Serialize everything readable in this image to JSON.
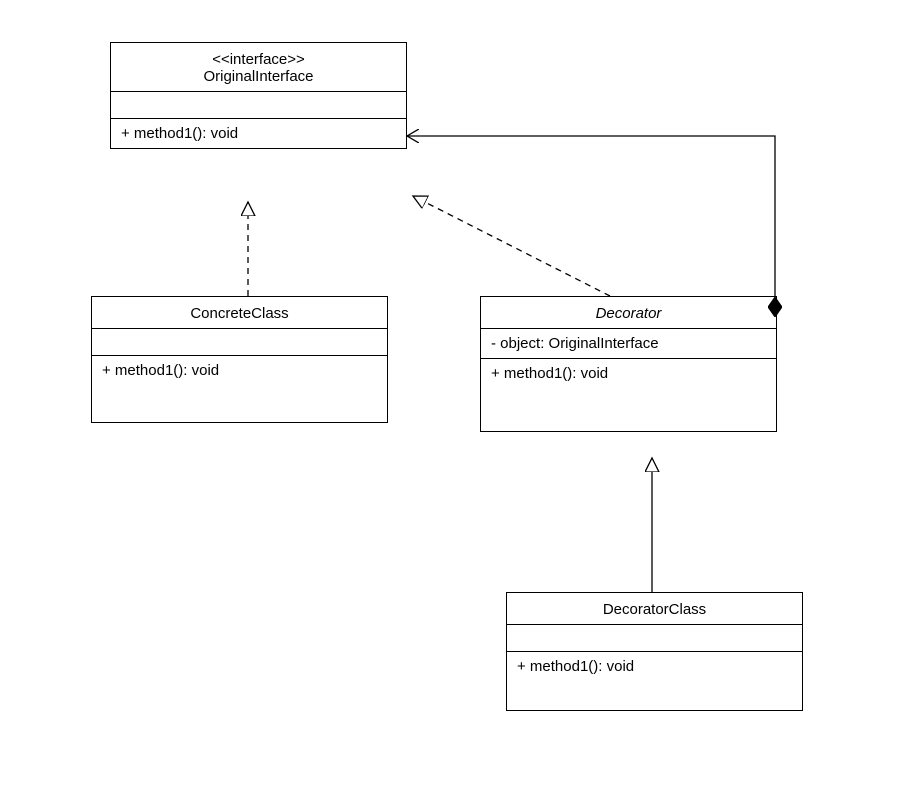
{
  "classes": {
    "originalInterface": {
      "stereotype": "<<interface>>",
      "name": "OriginalInterface",
      "attrs": "",
      "methods": "+ method1(): void"
    },
    "concreteClass": {
      "name": "ConcreteClass",
      "attrs": "",
      "methods": "+ method1(): void"
    },
    "decorator": {
      "name": "Decorator",
      "attrs": "- object: OriginalInterface",
      "methods": "+ method1(): void"
    },
    "decoratorClass": {
      "name": "DecoratorClass",
      "attrs": "",
      "methods": "+ method1(): void"
    }
  },
  "chart_data": {
    "type": "uml_class_diagram",
    "pattern": "Decorator",
    "classes": [
      {
        "id": "OriginalInterface",
        "stereotype": "interface",
        "abstract": true,
        "attributes": [],
        "methods": [
          "+ method1(): void"
        ]
      },
      {
        "id": "ConcreteClass",
        "attributes": [],
        "methods": [
          "+ method1(): void"
        ]
      },
      {
        "id": "Decorator",
        "abstract": true,
        "attributes": [
          "- object: OriginalInterface"
        ],
        "methods": [
          "+ method1(): void"
        ]
      },
      {
        "id": "DecoratorClass",
        "attributes": [],
        "methods": [
          "+ method1(): void"
        ]
      }
    ],
    "relations": [
      {
        "from": "ConcreteClass",
        "to": "OriginalInterface",
        "type": "realization"
      },
      {
        "from": "Decorator",
        "to": "OriginalInterface",
        "type": "realization"
      },
      {
        "from": "Decorator",
        "to": "OriginalInterface",
        "type": "composition"
      },
      {
        "from": "DecoratorClass",
        "to": "Decorator",
        "type": "generalization"
      }
    ]
  }
}
